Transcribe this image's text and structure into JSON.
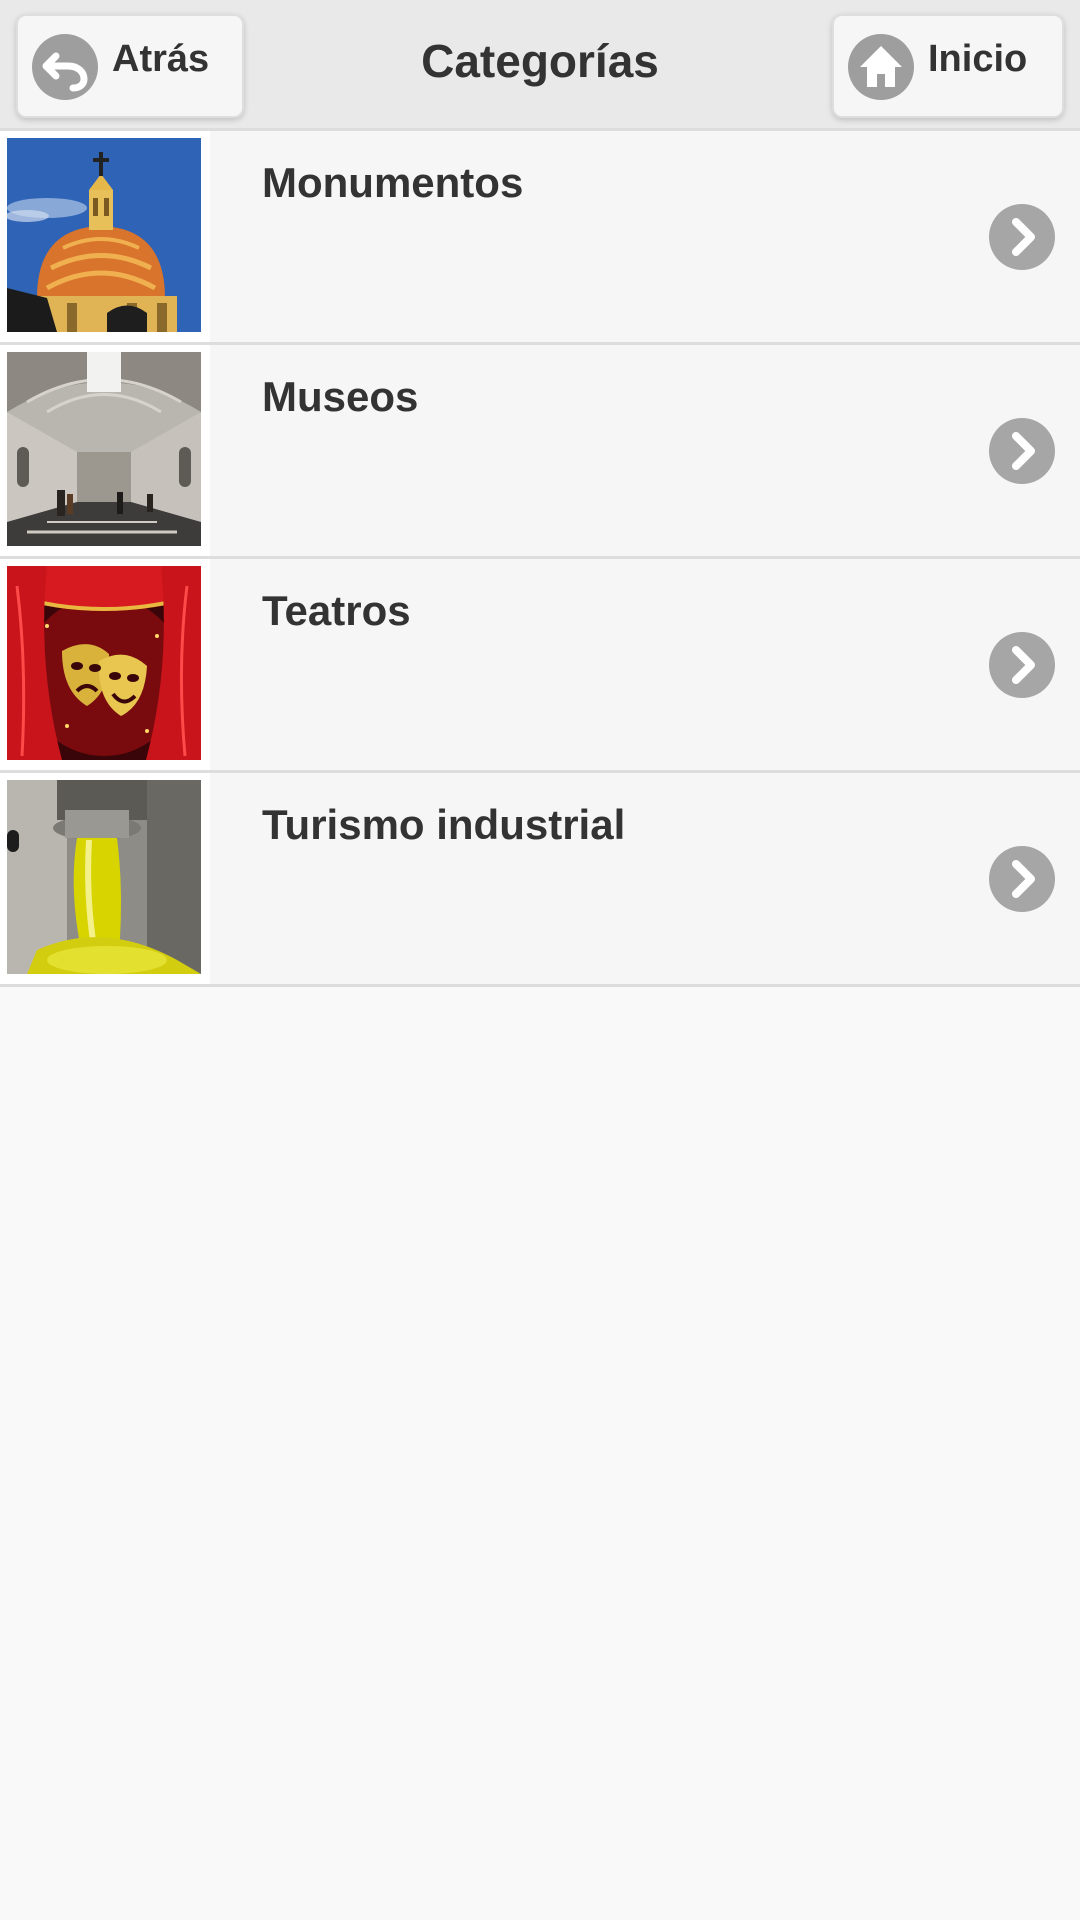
{
  "header": {
    "title": "Categorías",
    "back_label": "Atrás",
    "home_label": "Inicio"
  },
  "categories": [
    {
      "label": "Monumentos",
      "thumbnail": "dome-photo"
    },
    {
      "label": "Museos",
      "thumbnail": "museum-gallery-photo"
    },
    {
      "label": "Teatros",
      "thumbnail": "theater-masks-photo"
    },
    {
      "label": "Turismo industrial",
      "thumbnail": "olive-oil-pouring-photo"
    }
  ],
  "colors": {
    "header_bg": "#e9e9e9",
    "list_bg": "#f6f6f6",
    "page_bg": "#f9f9f9",
    "icon_gray": "#9e9e9e",
    "text": "#333333"
  }
}
